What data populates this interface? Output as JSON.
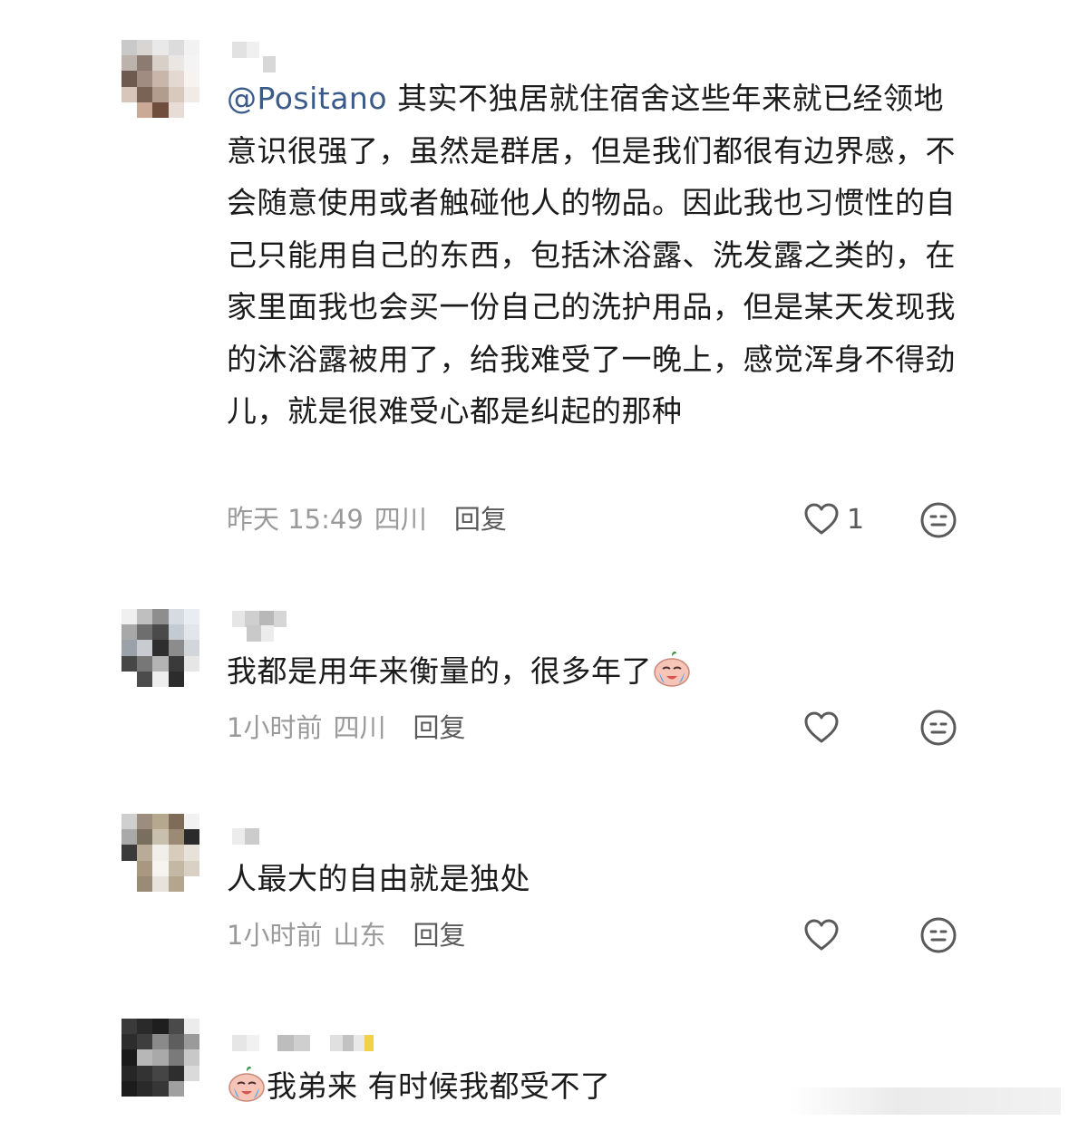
{
  "comments": [
    {
      "mention": "@Positano",
      "text": " 其实不独居就住宿舍这些年来就已经领地意识很强了，虽然是群居，但是我们都很有边界感，不会随意使用或者触碰他人的物品。因此我也习惯性的自己只能用自己的东西，包括沐浴露、洗发露之类的，在家里面我也会买一份自己的洗护用品，但是某天发现我的沐浴露被用了，给我难受了一晚上，感觉浑身不得劲儿，就是很难受心都是纠起的那种",
      "time": "昨天 15:49",
      "location": "四川",
      "reply_label": "回复",
      "like_count": "1"
    },
    {
      "text": "我都是用年来衡量的，很多年了",
      "emoji": "crying-face-emoji",
      "time": "1小时前",
      "location": "四川",
      "reply_label": "回复",
      "like_count": ""
    },
    {
      "text": "人最大的自由就是独处",
      "time": "1小时前",
      "location": "山东",
      "reply_label": "回复",
      "like_count": ""
    },
    {
      "emoji": "crying-face-emoji",
      "text": "我弟来 有时候我都受不了"
    }
  ],
  "colors": {
    "mention": "#3a5a8a",
    "meta_gray": "#9a9a9a",
    "icon_gray": "#5a5a5a"
  },
  "icons": {
    "like": "heart-outline-icon",
    "emoji_button": "smiley-face-icon"
  }
}
